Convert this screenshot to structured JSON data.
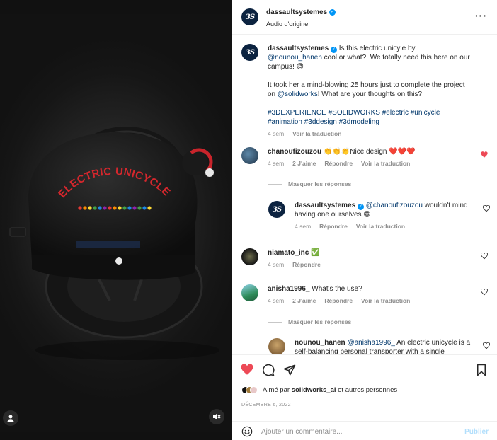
{
  "post": {
    "username": "dassaultsystemes",
    "audio": "Audio d'origine",
    "logo_text": "3S"
  },
  "caption": {
    "username": "dassaultsystemes",
    "text_1": "Is this electric unicyle by ",
    "mention_1": "@nounou_hanen",
    "text_2": " cool or what?! We totally need this here on our campus! 😍",
    "text_3": "It took her a mind-blowing 25 hours just to complete the project on ",
    "mention_2": "@solidworks",
    "text_4": "! What are your thoughts on this?",
    "hashtags": "#3DEXPERIENCE #SOLIDWORKS #electric #unicycle #animation #3ddesign #3dmodeling",
    "time": "4 sem",
    "translate": "Voir la traduction"
  },
  "comments": [
    {
      "username": "chanoufizouzou",
      "text": "👏👏👏Nice design ❤️❤️❤️",
      "time": "4 sem",
      "likes": "2 J'aime",
      "reply": "Répondre",
      "translate": "Voir la traduction",
      "liked": true,
      "hide_replies": "Masquer les réponses",
      "reply_item": {
        "username": "dassaultsystemes",
        "mention": "@chanoufizouzou",
        "text": " wouldn't mind having one ourselves 😁",
        "time": "4 sem",
        "reply": "Répondre",
        "translate": "Voir la traduction"
      }
    },
    {
      "username": "niamato_inc",
      "text": "✅",
      "time": "4 sem",
      "reply": "Répondre"
    },
    {
      "username": "anisha1996_",
      "text": "What's the use?",
      "time": "4 sem",
      "likes": "2 J'aime",
      "reply": "Répondre",
      "translate": "Voir la traduction",
      "hide_replies": "Masquer les réponses",
      "reply_item": {
        "username": "nounou_hanen",
        "mention": "@anisha1996_",
        "text": " An electric unicycle is a self-balancing personal transporter with a single"
      }
    }
  ],
  "media": {
    "product_label": "ELECTRIC UNICYCLE"
  },
  "footer": {
    "liked_by_prefix": "Aimé par ",
    "liked_by_user": "solidworks_ai",
    "liked_by_suffix": " et autres personnes",
    "date": "DÉCEMBRE 6, 2022",
    "comment_placeholder": "Ajouter un commentaire...",
    "publish_label": "Publier"
  },
  "colors": {
    "like_red": "#ed4956",
    "link_blue": "#00376b",
    "verified_blue": "#0095f6",
    "brand_navy": "#0c2340",
    "publish_disabled": "#b2dffc"
  },
  "icons": [
    "user-tag-icon",
    "mute-icon",
    "more-icon",
    "heart-icon",
    "comment-icon",
    "share-icon",
    "bookmark-icon",
    "emoji-icon",
    "verified-icon"
  ]
}
